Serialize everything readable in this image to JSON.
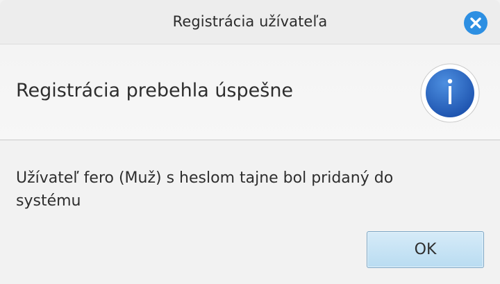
{
  "window": {
    "title": "Registrácia užívateľa"
  },
  "header": {
    "text": "Registrácia prebehla úspešne",
    "icon": "info-icon"
  },
  "content": {
    "message": "Užívateľ fero (Muž) s heslom tajne bol pridaný do systému"
  },
  "buttons": {
    "ok_label": "OK"
  },
  "colors": {
    "accent": "#2d8fe2",
    "info_icon": "#2f6fc6",
    "button_bg": "#c6e3f5"
  },
  "icons": {
    "close": "close-icon",
    "info": "info-icon"
  }
}
